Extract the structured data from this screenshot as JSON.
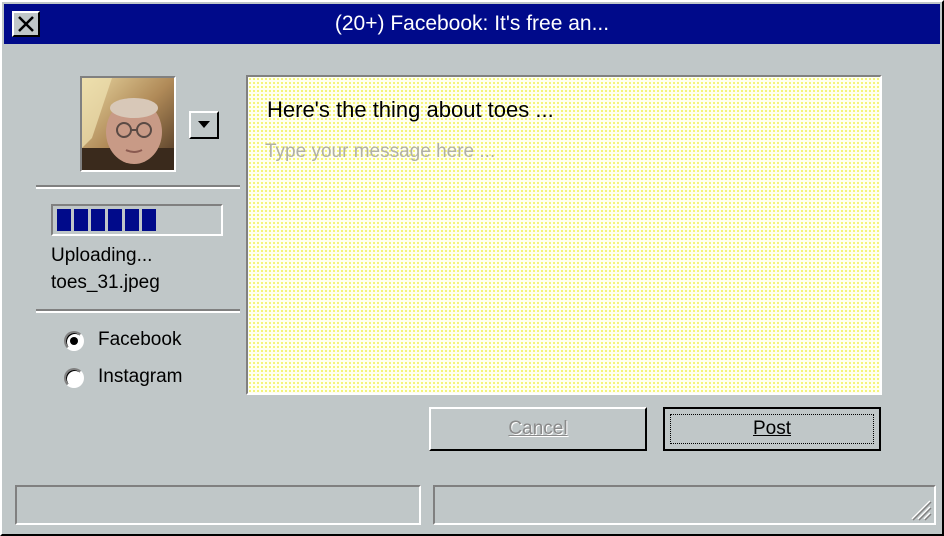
{
  "window": {
    "title": "(20+) Facebook: It's free an..."
  },
  "titlebar": {
    "close_glyph": "✕"
  },
  "profile": {
    "dropdown_glyph": "▼"
  },
  "upload": {
    "progress": 0.6,
    "status": "Uploading...",
    "filename": "toes_31.jpeg"
  },
  "networks": {
    "selected": "Facebook",
    "options": [
      "Facebook",
      "Instagram"
    ]
  },
  "message": {
    "title": "Here's the thing about toes ...",
    "value": "",
    "placeholder": "Type your message here ..."
  },
  "buttons": {
    "cancel": "Cancel",
    "post": "Post"
  },
  "colors": {
    "titlebar": "#000a8a",
    "face": "#c0c7c8",
    "progress_fill": "#000a8a",
    "message_bg_dots": "#f2f25c"
  },
  "icons": [
    "close-icon",
    "chevron-down-icon",
    "resize-grip-icon"
  ]
}
